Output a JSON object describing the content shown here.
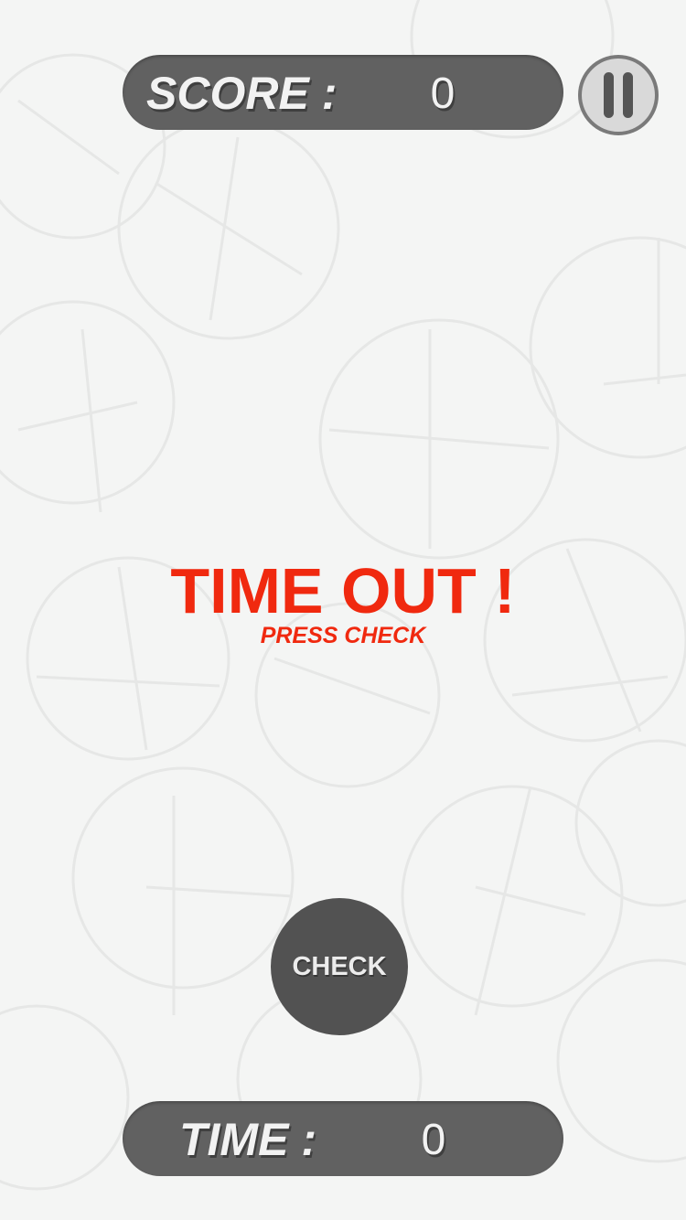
{
  "colors": {
    "background": "#f4f5f4",
    "bar": "#616161",
    "accent_red": "#f0290f",
    "check_button": "#525252"
  },
  "hud": {
    "score_label": "SCORE :",
    "score_value": "0",
    "time_label": "TIME :",
    "time_value": "0",
    "pause_icon": "pause-icon"
  },
  "message": {
    "title": "TIME OUT !",
    "subtitle": "PRESS CHECK"
  },
  "controls": {
    "check_label": "CHECK"
  }
}
